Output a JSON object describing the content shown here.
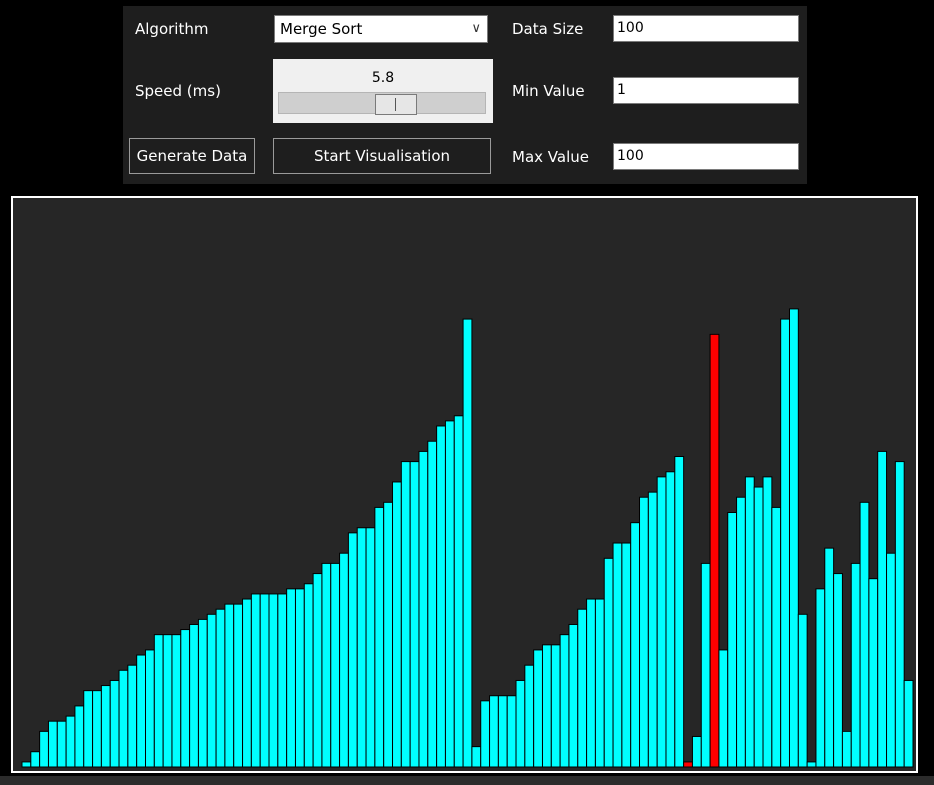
{
  "controls": {
    "algorithm_label": "Algorithm",
    "algorithm_selected": "Merge Sort",
    "speed_label": "Speed (ms)",
    "speed_value": "5.8",
    "speed_slider_fraction": 0.52,
    "generate_button": "Generate Data",
    "start_button": "Start Visualisation",
    "data_size_label": "Data Size",
    "data_size_value": "100",
    "min_value_label": "Min Value",
    "min_value_value": "1",
    "max_value_label": "Max Value",
    "max_value_value": "100"
  },
  "colors": {
    "panel_bg": "#1e1e1e",
    "canvas_bg": "#262626",
    "bar_default": "#00ffff",
    "bar_highlight": "#ff0000",
    "bar_outline": "#000000"
  },
  "chart_data": {
    "type": "bar",
    "ylim": [
      0,
      100
    ],
    "values": [
      1,
      3,
      7,
      9,
      9,
      10,
      12,
      15,
      15,
      16,
      17,
      19,
      20,
      22,
      23,
      26,
      26,
      26,
      27,
      28,
      29,
      30,
      31,
      32,
      32,
      33,
      34,
      34,
      34,
      34,
      35,
      35,
      36,
      38,
      40,
      40,
      42,
      46,
      47,
      47,
      51,
      52,
      56,
      60,
      60,
      62,
      64,
      67,
      68,
      69,
      88,
      4,
      13,
      14,
      14,
      14,
      17,
      20,
      23,
      24,
      24,
      26,
      28,
      31,
      33,
      33,
      41,
      44,
      44,
      48,
      53,
      54,
      57,
      58,
      61,
      1,
      6,
      40,
      85,
      23,
      50,
      53,
      57,
      55,
      57,
      51,
      88,
      90,
      30,
      1,
      35,
      43,
      38,
      7,
      40,
      52,
      37,
      62,
      42,
      60,
      17
    ],
    "highlight_indices": [
      75,
      78
    ]
  }
}
